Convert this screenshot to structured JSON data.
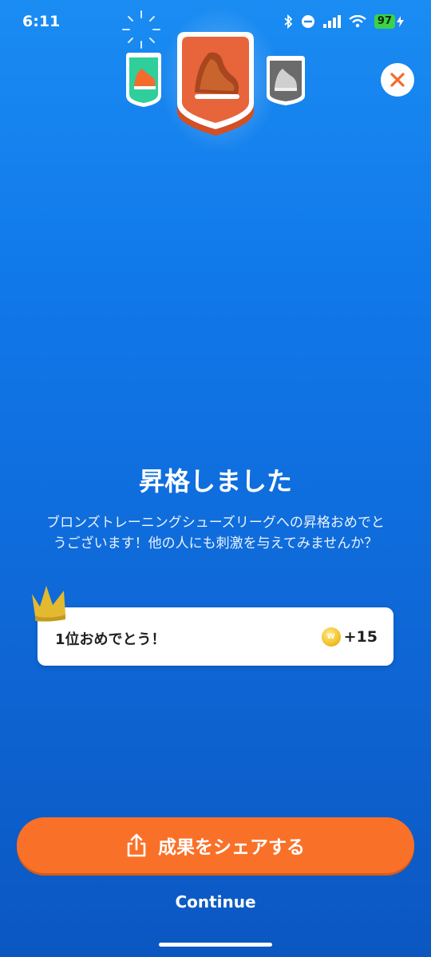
{
  "status_bar": {
    "time": "6:11",
    "battery": "97"
  },
  "badges": {
    "left_icon": "green-running-shoe-badge-icon",
    "center_icon": "bronze-shoe-badge-icon",
    "right_icon": "gray-shoe-badge-icon"
  },
  "title": "昇格しました",
  "description": "ブロンズトレーニングシューズリーグへの昇格おめでとうございます！他の人にも刺激を与えてみませんか？",
  "reward_card": {
    "text": "1位おめでとう！",
    "coin_letter": "W",
    "amount": "+15"
  },
  "share_button": {
    "label": "成果をシェアする"
  },
  "continue_label": "Continue",
  "colors": {
    "accent_orange": "#f97128",
    "background_blue": "#1078ea"
  }
}
